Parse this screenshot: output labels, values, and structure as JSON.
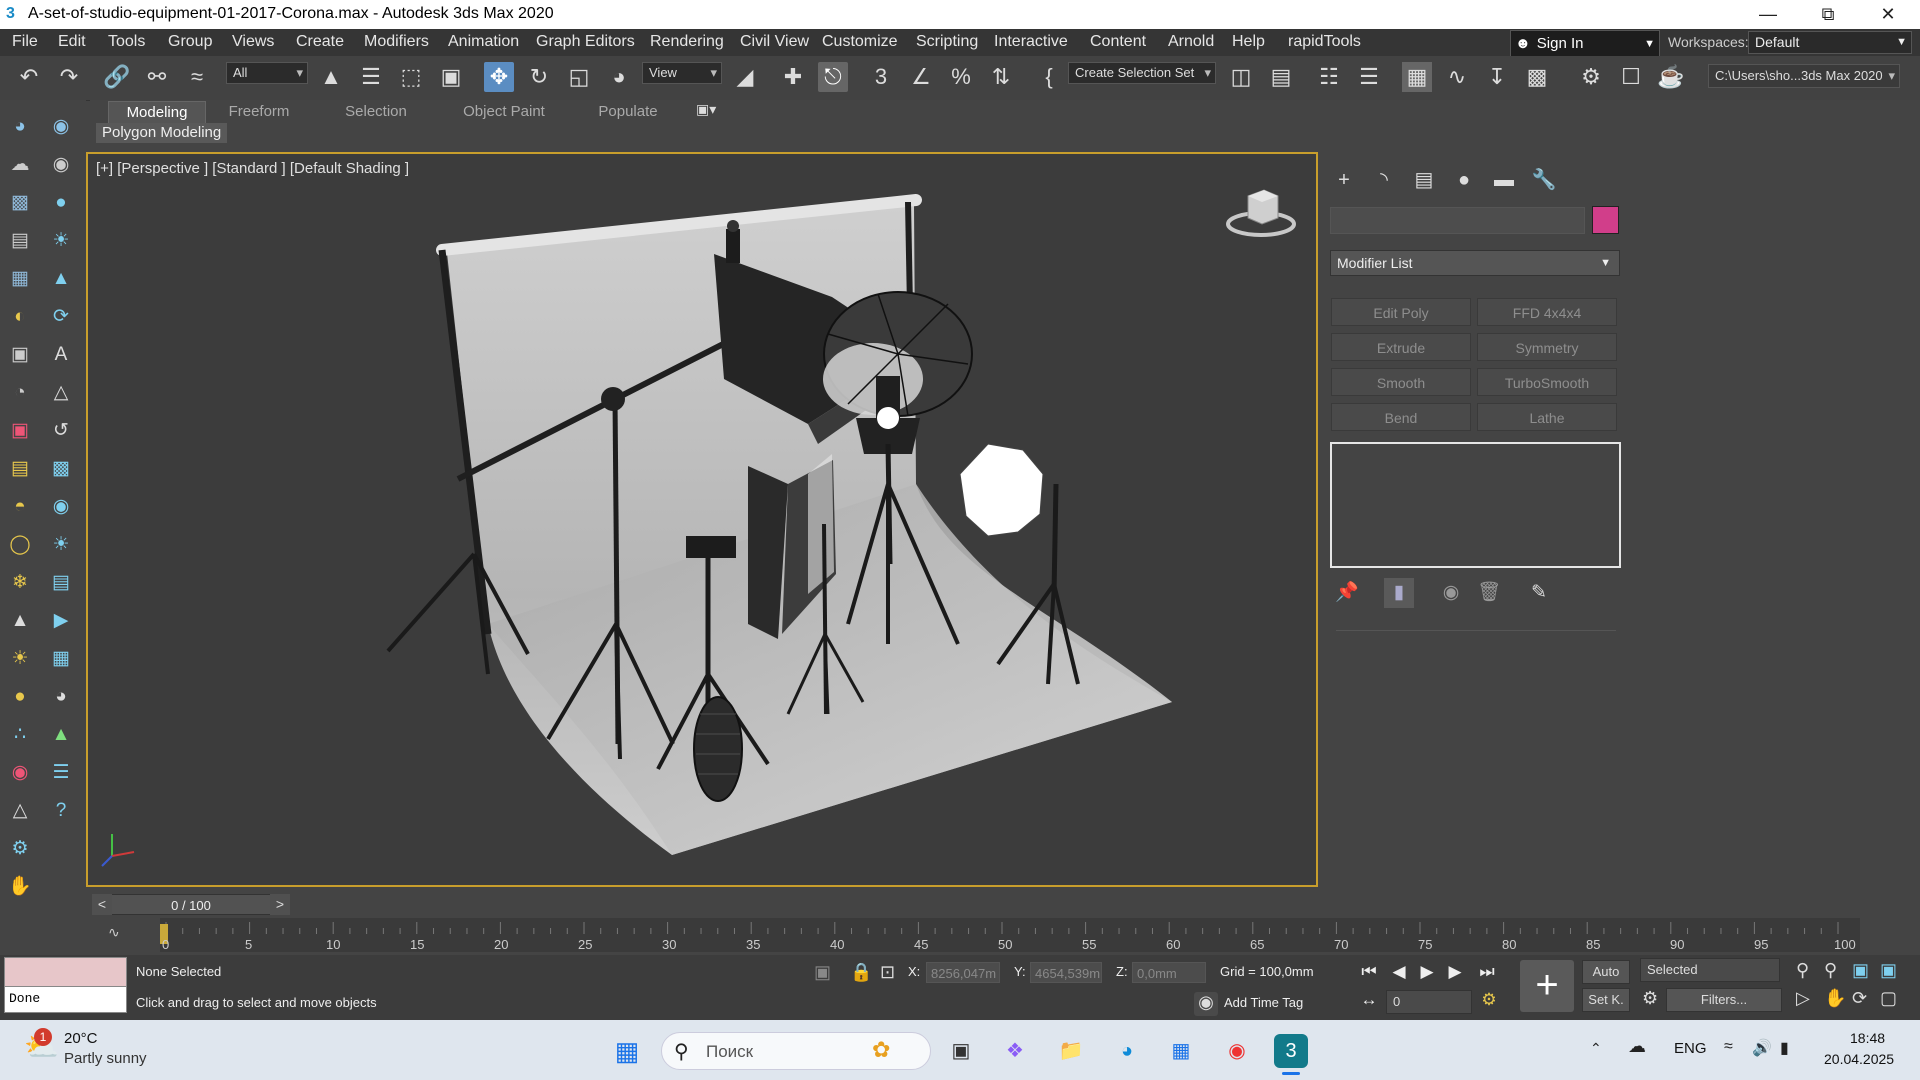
{
  "window": {
    "title": "A-set-of-studio-equipment-01-2017-Corona.max - Autodesk 3ds Max 2020",
    "app_icon": "3"
  },
  "menu": [
    "File",
    "Edit",
    "Tools",
    "Group",
    "Views",
    "Create",
    "Modifiers",
    "Animation",
    "Graph Editors",
    "Rendering",
    "Civil View",
    "Customize",
    "Scripting",
    "Interactive",
    "Content",
    "Arnold",
    "Help",
    "rapidTools"
  ],
  "account": {
    "sign_in": "Sign In",
    "workspaces_label": "Workspaces:",
    "workspace": "Default"
  },
  "toolbar": {
    "filter": "All",
    "reference": "View",
    "selection_set": "Create Selection Set",
    "project_path": "C:\\Users\\sho...3ds Max 2020"
  },
  "ribbon": {
    "tabs": [
      "Modeling",
      "Freeform",
      "Selection",
      "Object Paint",
      "Populate"
    ],
    "active_tab": "Modeling",
    "panel": "Polygon Modeling"
  },
  "viewport": {
    "label": "[+] [Perspective ] [Standard ] [Default Shading ]"
  },
  "command_panel": {
    "modifier_list": "Modifier List",
    "swatch_color": "#d13e8a",
    "modifiers": [
      "Edit Poly",
      "FFD 4x4x4",
      "Extrude",
      "Symmetry",
      "Smooth",
      "TurboSmooth",
      "Bend",
      "Lathe"
    ]
  },
  "timeline": {
    "frame": "0 / 100",
    "ticks": [
      "0",
      "5",
      "10",
      "15",
      "20",
      "25",
      "30",
      "35",
      "40",
      "45",
      "50",
      "55",
      "60",
      "65",
      "70",
      "75",
      "80",
      "85",
      "90",
      "95",
      "100"
    ]
  },
  "status": {
    "script_output": "Done",
    "selection": "None Selected",
    "prompt": "Click and drag to select and move objects",
    "x_label": "X:",
    "x": "8256,047m",
    "y_label": "Y:",
    "y": "4654,539m",
    "z_label": "Z:",
    "z": "0,0mm",
    "grid": "Grid = 100,0mm",
    "add_time_tag": "Add Time Tag",
    "auto": "Auto",
    "selected": "Selected",
    "set_key": "Set K.",
    "filters": "Filters...",
    "frame_field": "0"
  },
  "taskbar": {
    "weather_temp": "20°C",
    "weather_desc": "Partly sunny",
    "weather_badge": "1",
    "search_placeholder": "Поиск",
    "language": "ENG",
    "time": "18:48",
    "date": "20.04.2025"
  }
}
